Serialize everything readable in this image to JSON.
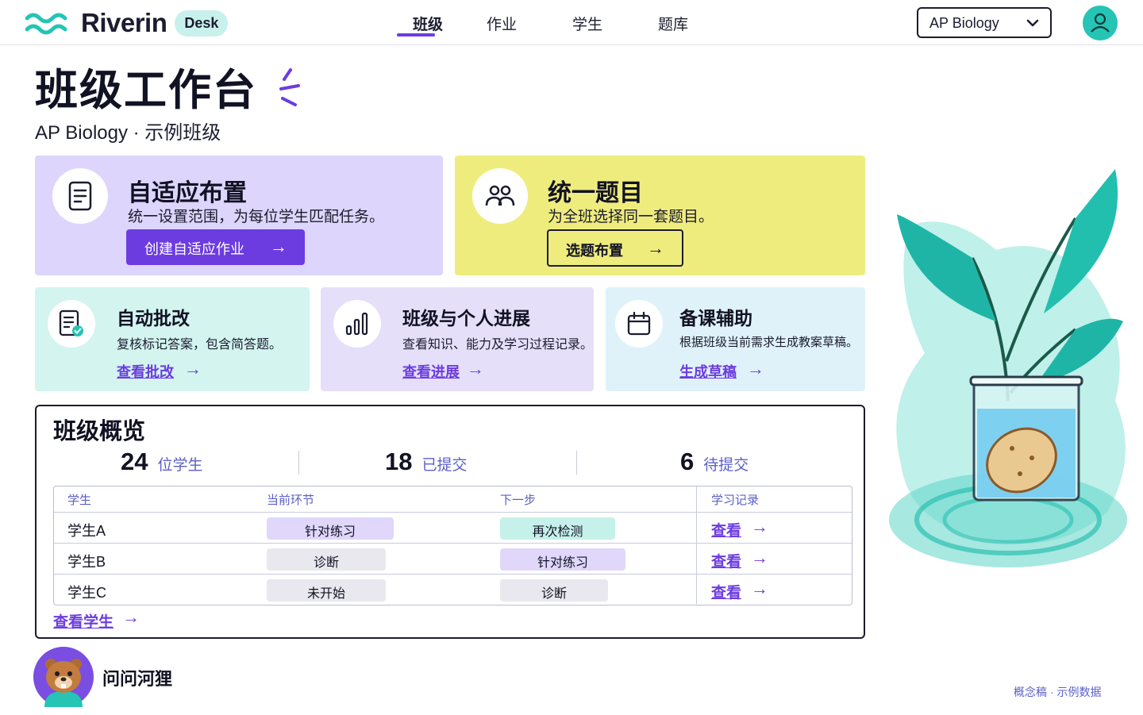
{
  "header": {
    "brand": "Riverin",
    "badge": "Desk",
    "nav": [
      "班级",
      "作业",
      "学生",
      "题库"
    ],
    "active_nav": "班级",
    "course_select": "AP Biology"
  },
  "page": {
    "title": "班级工作台",
    "subtitle": "AP Biology · 示例班级"
  },
  "cards_primary": [
    {
      "title": "自适应布置",
      "desc": "统一设置范围，为每位学生匹配任务。",
      "button": "创建自适应作业",
      "icon": "document-icon"
    },
    {
      "title": "统一题目",
      "desc": "为全班选择同一套题目。",
      "button": "选题布置",
      "icon": "group-icon"
    }
  ],
  "cards_secondary": [
    {
      "title": "自动批改",
      "desc": "复核标记答案，包含简答题。",
      "link": "查看批改",
      "icon": "checked-document-icon"
    },
    {
      "title": "班级与个人进展",
      "desc": "查看知识、能力及学习过程记录。",
      "link": "查看进展",
      "icon": "bar-chart-icon"
    },
    {
      "title": "备课辅助",
      "desc": "根据班级当前需求生成教案草稿。",
      "link": "生成草稿",
      "icon": "calendar-icon"
    }
  ],
  "overview": {
    "title": "班级概览",
    "stats": [
      {
        "value": "24",
        "label": "位学生"
      },
      {
        "value": "18",
        "label": "已提交"
      },
      {
        "value": "6",
        "label": "待提交"
      }
    ],
    "columns": [
      "学生",
      "当前环节",
      "下一步",
      "学习记录"
    ],
    "rows": [
      {
        "student": "学生A",
        "current": "针对练习",
        "next": "再次检测",
        "record": "查看"
      },
      {
        "student": "学生B",
        "current": "诊断",
        "next": "针对练习",
        "record": "查看"
      },
      {
        "student": "学生C",
        "current": "未开始",
        "next": "诊断",
        "record": "查看"
      }
    ],
    "view_students": "查看学生"
  },
  "assistant": {
    "name": "问问河狸"
  },
  "footer": {
    "note": "概念稿 · 示例数据"
  },
  "colors": {
    "accent": "#6c3ce0",
    "teal": "#25c4b4",
    "purple_card": "#ddd5fb",
    "yellow_card": "#efec7e"
  }
}
